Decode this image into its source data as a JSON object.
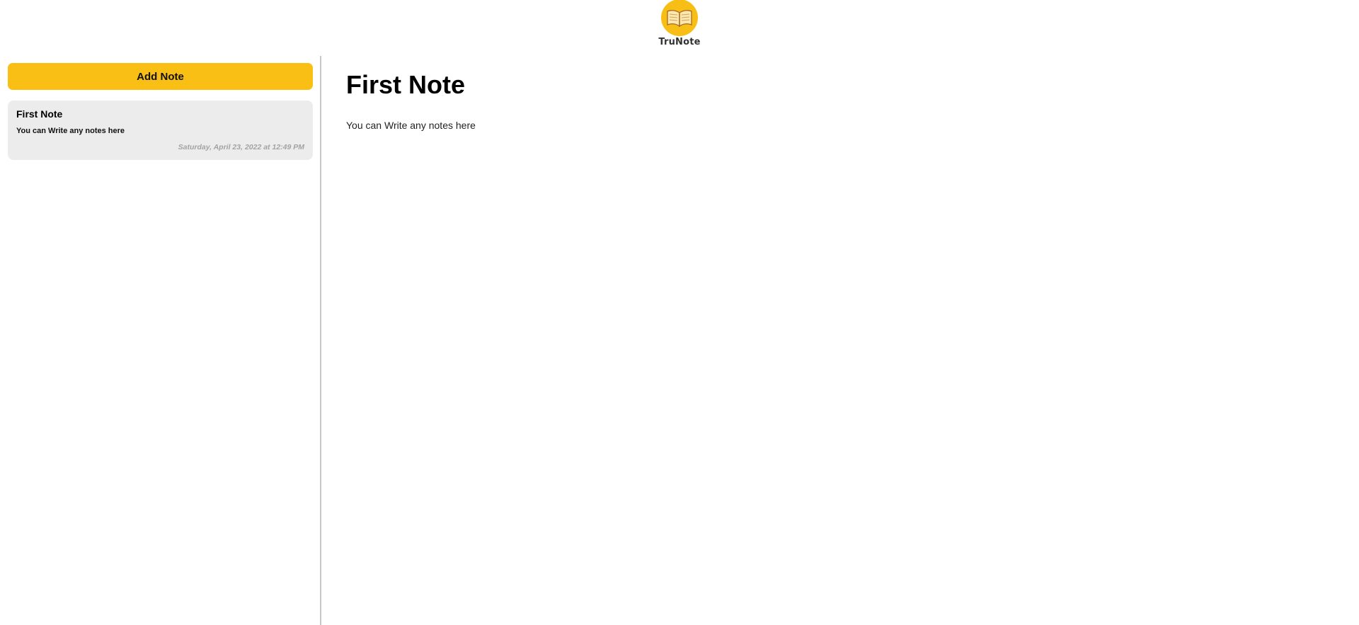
{
  "header": {
    "logo_text": "TruNote",
    "logo_icon": "open-book-icon",
    "brand_color": "#f7bf16"
  },
  "sidebar": {
    "add_button_label": "Add Note",
    "notes": [
      {
        "title": "First Note",
        "preview": "You can Write any notes here",
        "date": "Saturday, April 23, 2022 at 12:49 PM"
      }
    ]
  },
  "main": {
    "note_title": "First Note",
    "note_body": "You can Write any notes here"
  }
}
